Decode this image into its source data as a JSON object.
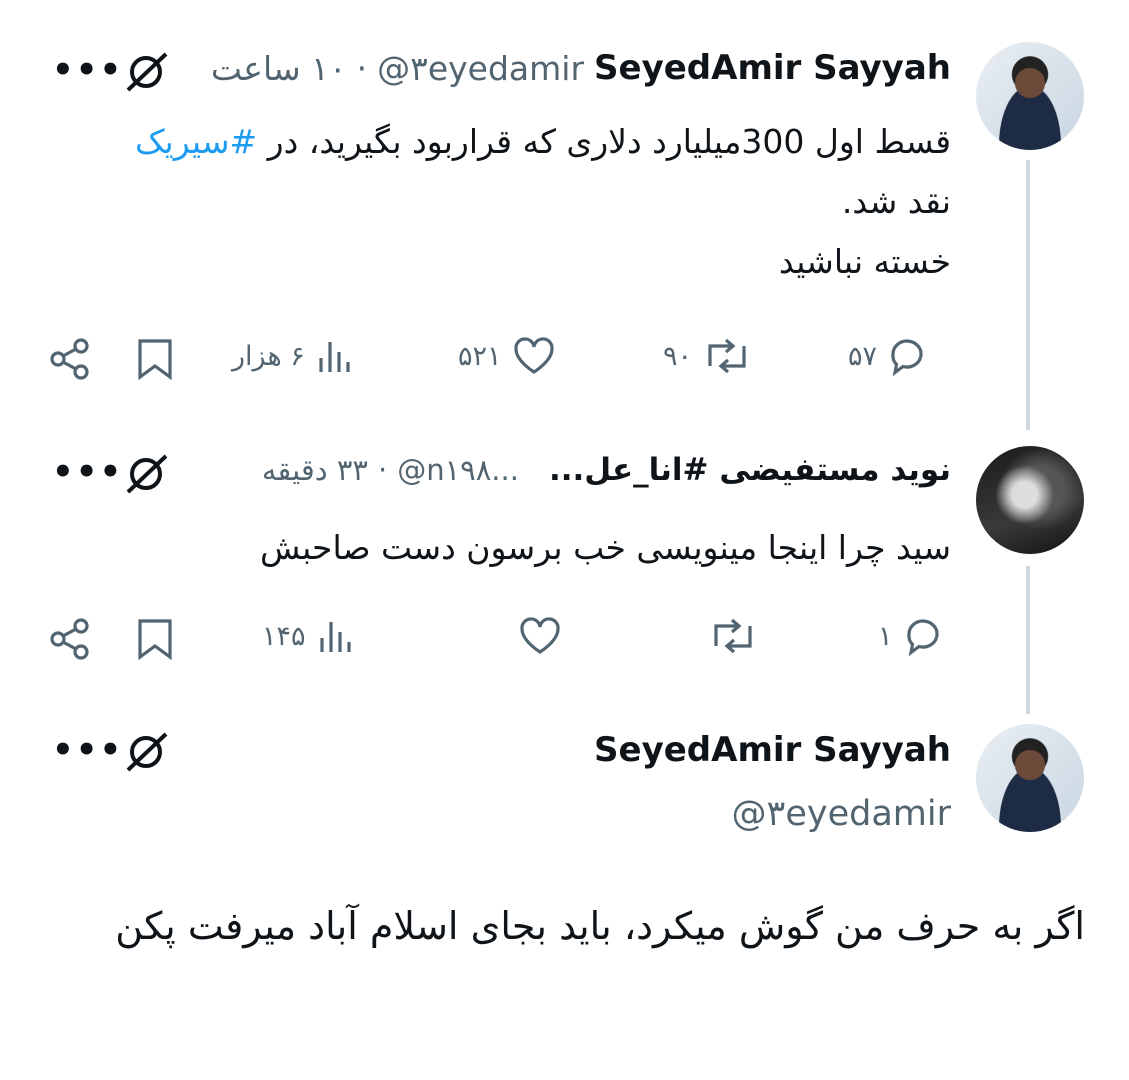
{
  "tweet1": {
    "name": "SeyedAmir Sayyah",
    "handle": "@۳eyedamir",
    "time": "۱۰ ساعت",
    "separator": "·",
    "text_prefix": "قسط اول 300میلیارد دلاری که قراربود بگیرید، در ",
    "hashtag": "#سیریک",
    "line2": "نقد شد.",
    "line3": "خسته نباشید",
    "replies": "۵۷",
    "retweets": "۹۰",
    "likes": "۵۲۱",
    "views": "۶ هزار"
  },
  "tweet2": {
    "name": "نوید مستفیضی #انا_عل...",
    "handle": "@n۱۹۸...",
    "time": "۳۳ دقیقه",
    "separator": "·",
    "text": "سید چرا اینجا مینویسی خب برسون دست صاحبش",
    "replies": "۱",
    "views": "۱۴۵"
  },
  "tweet3": {
    "name": "SeyedAmir Sayyah",
    "handle": "@۳eyedamir",
    "text": "اگر به حرف من گوش میکرد، باید بجای اسلام آباد میرفت پکن"
  },
  "more_label": "•••",
  "colors": {
    "hashtag": "#1d9bf0",
    "muted": "#536471",
    "line": "#cfd9de"
  }
}
